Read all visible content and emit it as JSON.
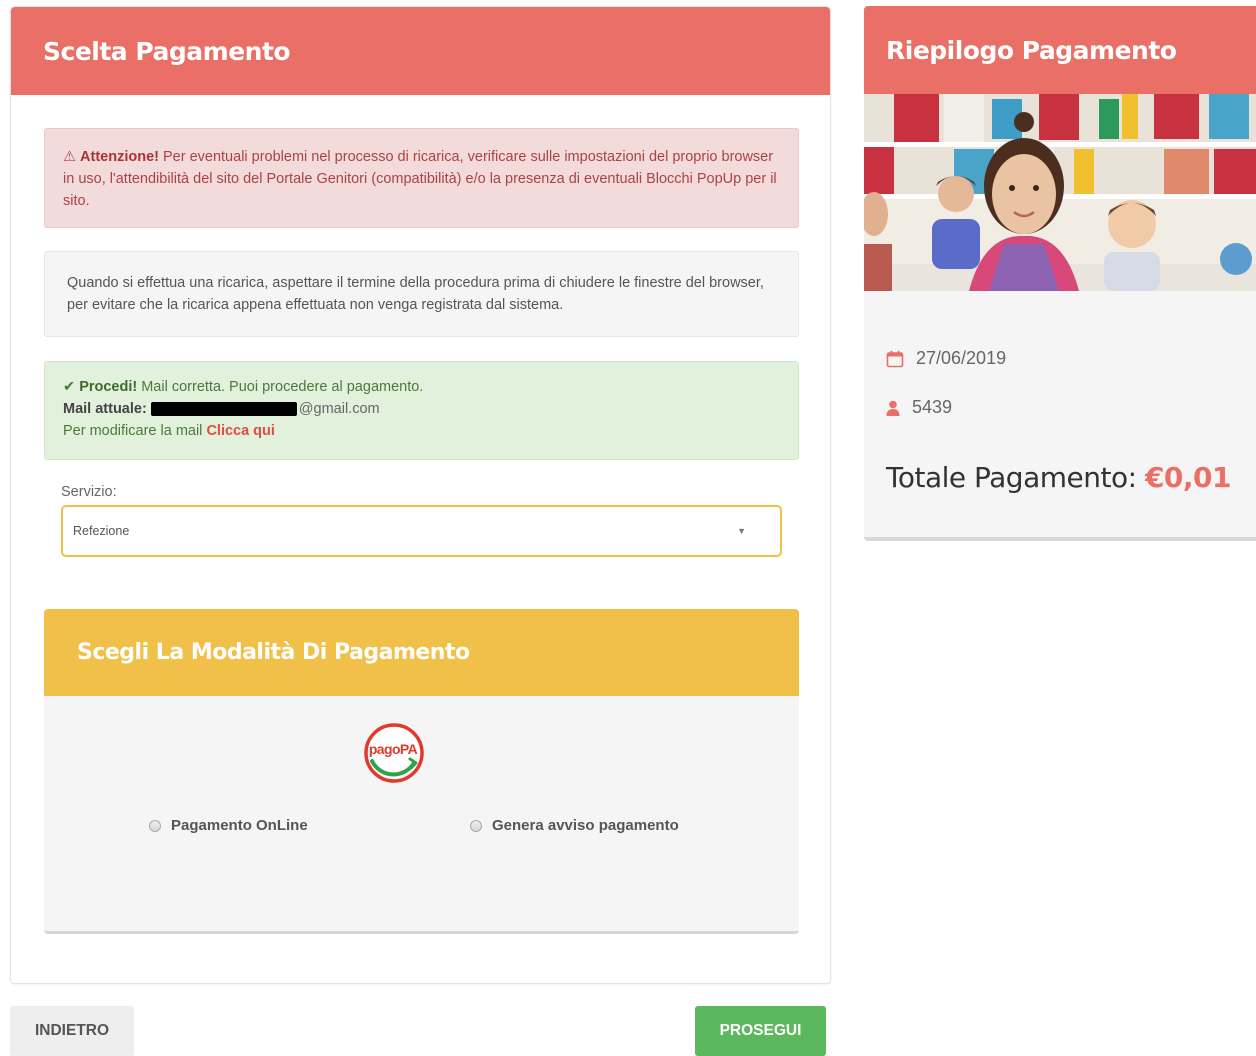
{
  "payment_choice": {
    "title": "Scelta Pagamento",
    "warning": {
      "label": "Attenzione!",
      "text": " Per eventuali problemi nel processo di ricarica, verificare sulle impostazioni del proprio browser in uso, l'attendibilità del sito del Portale Genitori (compatibilità) e/o la presenza di eventuali Blocchi PopUp per il sito."
    },
    "info_text": "Quando si effettua una ricarica, aspettare il termine della procedura prima di chiudere le finestre del browser, per evitare che la ricarica appena effettuata non venga registrata dal sistema.",
    "success": {
      "label": "Procedi!",
      "text": " Mail corretta. Puoi procedere al pagamento.",
      "mail_label": "Mail attuale:",
      "mail_domain": "@gmail.com",
      "modify_text": "Per modificare la mail ",
      "modify_link": "Clicca qui"
    },
    "service": {
      "label": "Servizio:",
      "value": "Refezione"
    },
    "mode": {
      "title": "Scegli La Modalità Di Pagamento",
      "logo_text": "pagoPA",
      "options": [
        {
          "label": "Pagamento OnLine",
          "selected": false
        },
        {
          "label": "Genera avviso pagamento",
          "selected": false
        }
      ]
    },
    "buttons": {
      "back": "INDIETRO",
      "next": "PROSEGUI"
    }
  },
  "summary": {
    "title": "Riepilogo Pagamento",
    "date": "27/06/2019",
    "user_id": "5439",
    "total_label": "Totale Pagamento:",
    "total_amount": "€0,01"
  },
  "colors": {
    "header": "#ea6f66",
    "mode_header": "#f0c048",
    "proceed_button": "#5cb85c"
  }
}
